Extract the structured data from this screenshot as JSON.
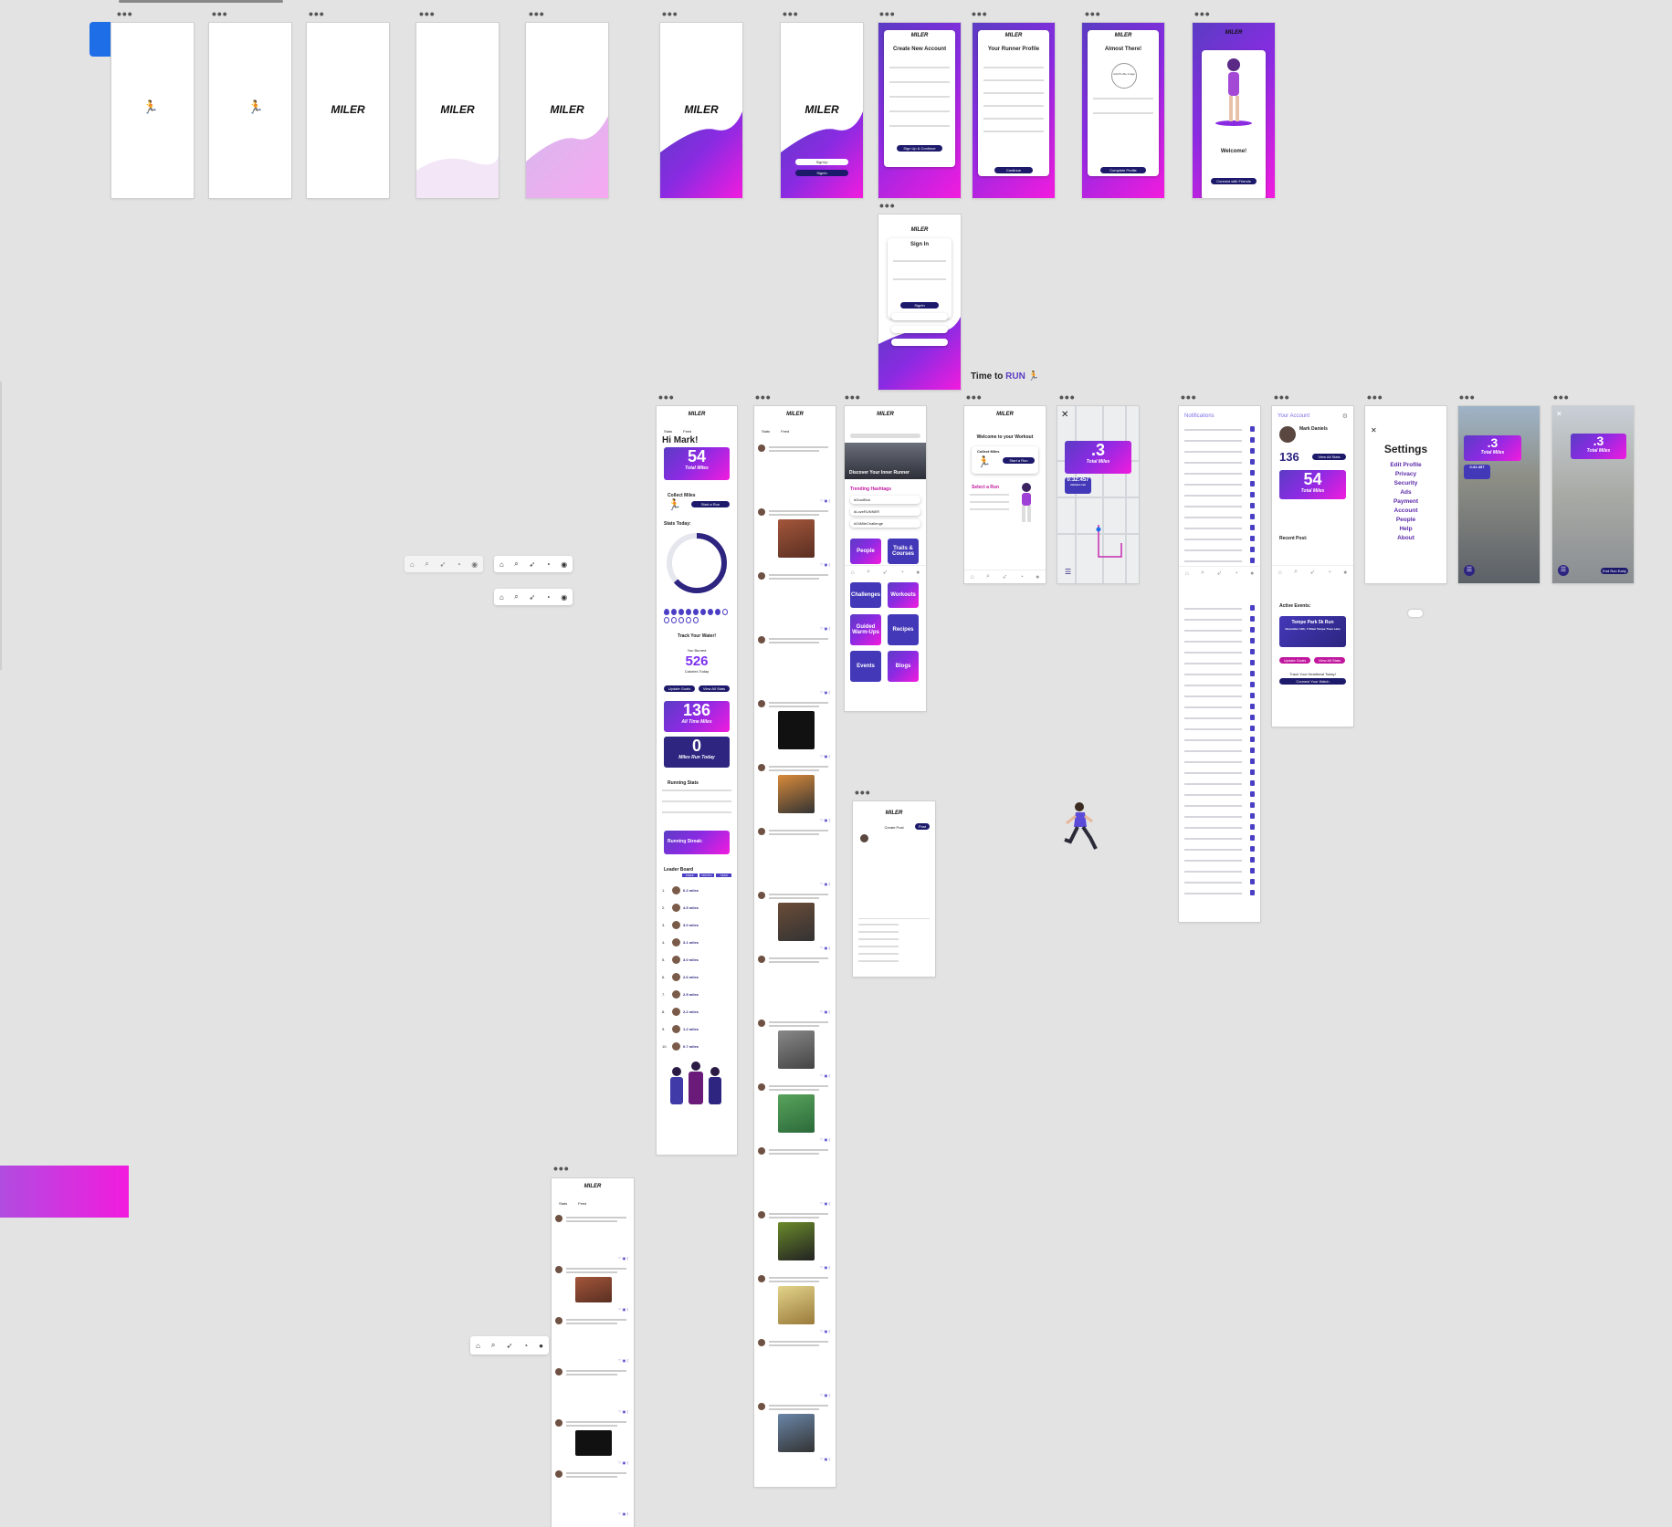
{
  "brand": {
    "logo_text": "MILER"
  },
  "onboarding": {
    "create_account_title": "Create New Account",
    "create_account_button": "Sign Up & Continue",
    "runner_profile_title": "Your Runner Profile",
    "continue_button": "Continue",
    "almost_there_title": "Almost There!",
    "add_profile_image": "Add Profile Image",
    "complete_profile_button": "Complete Profile",
    "welcome_title": "Welcome!",
    "welcome_button": "Connect with Friends",
    "sign_in_title": "Sign In",
    "sign_in_button": "SignIn",
    "splash_signup": "SignUp",
    "splash_signin": "SignIn"
  },
  "tagline": {
    "prefix": "Time to ",
    "highlight": "RUN"
  },
  "home": {
    "tabs": [
      "Stats",
      "Feed"
    ],
    "greeting": "Hi Mark!",
    "total_miles_value": "54",
    "total_miles_label": "Total Miles",
    "collect_miles_label": "Collect Miles",
    "start_run_button": "Start a Run",
    "stats_today_label": "Stats Today:",
    "track_water_label": "Track Your Water!",
    "you_burned_label": "You Burned",
    "calories_value": "526",
    "calories_label": "Calories Today",
    "update_goals_button": "Update Goals",
    "view_all_stats_button": "View All Stats",
    "all_time_value": "136",
    "all_time_label": "All Time Miles",
    "today_value": "0",
    "today_label": "Miles Run Today",
    "running_stats_label": "Running Stats",
    "streak_label": "Running Streak:",
    "leaderboard_label": "Leader Board",
    "leaderboard_tabs": [
      "WEEK",
      "MONTH",
      "YEAR"
    ],
    "leaderboard": [
      {
        "rank": "1.",
        "miles": "6.2 miles"
      },
      {
        "rank": "2.",
        "miles": "4.5 miles"
      },
      {
        "rank": "3.",
        "miles": "3.0 miles"
      },
      {
        "rank": "4.",
        "miles": "3.1 miles"
      },
      {
        "rank": "5.",
        "miles": "3.0 miles"
      },
      {
        "rank": "6.",
        "miles": "2.6 miles"
      },
      {
        "rank": "7.",
        "miles": "2.5 miles"
      },
      {
        "rank": "8.",
        "miles": "2.2 miles"
      },
      {
        "rank": "9.",
        "miles": "1.2 miles"
      },
      {
        "rank": "10.",
        "miles": "0.7 miles"
      }
    ]
  },
  "discover": {
    "banner": "Discover Your Inner Runner",
    "trending_label": "Trending Hashtags",
    "hashtags": [
      "#GoalKick",
      "#LoveRUNNER",
      "#24MileChallenge"
    ],
    "tiles": [
      "People",
      "Trails & Courses",
      "Challenges",
      "Workouts",
      "Guided Warm-Ups",
      "Recipes",
      "Events",
      "Blogs"
    ]
  },
  "workout": {
    "welcome": "Welcome to your Workout",
    "collect_miles": "Collect Miles",
    "start_run": "Start a Run",
    "select_run": "Select a Run"
  },
  "run_tracker": {
    "miles_value": ".3",
    "miles_label": "Total Miles",
    "time_value": "0:32:457",
    "time_label": "minutes ran",
    "end_run": "End Run Early"
  },
  "notifications": {
    "title": "Notifications"
  },
  "account": {
    "title": "Your Account",
    "name": "Mark Daniels",
    "all_time_value": "136",
    "all_time_label": "All Time Miles",
    "view_all_stats": "View All Stats",
    "total_value": "54",
    "total_label": "Total Miles",
    "recent_post": "Recent Post:",
    "active_events": "Active Events:",
    "event_name": "Tempe Park 5k Run",
    "event_sub": "November 14th, 7:00am Tempe Town Lake",
    "update_goals": "Update Goals",
    "view_all": "View All Stats",
    "track_heartbeat": "Track Your Heartbeat Today!",
    "connect_watch": "Connect Your Watch"
  },
  "settings": {
    "title": "Settings",
    "items": [
      "Edit Profile",
      "Privacy",
      "Security",
      "Ads",
      "Payment",
      "Account",
      "People",
      "Help",
      "About"
    ]
  },
  "create_post": {
    "title": "Create Post",
    "post_button": "Post"
  },
  "colors": {
    "gradient_start": "#5b3cc4",
    "gradient_mid": "#8a2be2",
    "gradient_end": "#f21bde",
    "navy": "#1d1a6b",
    "accent": "#7b2ff0"
  }
}
